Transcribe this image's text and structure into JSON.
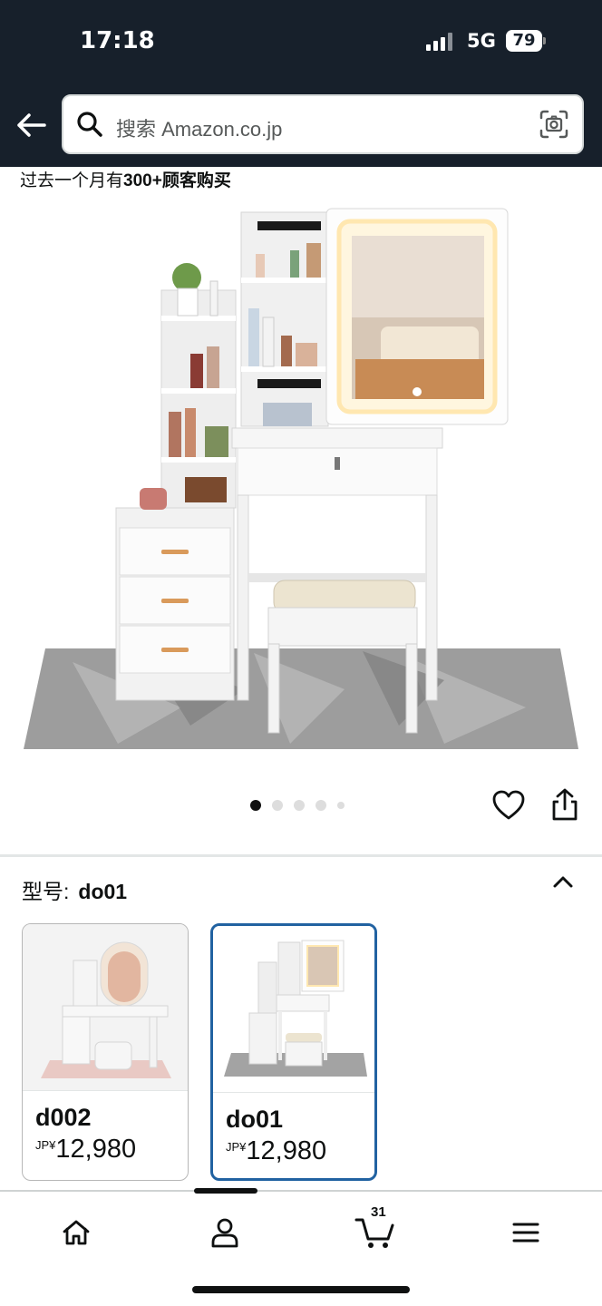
{
  "status_bar": {
    "time": "17:18",
    "network": "5G",
    "battery": "79"
  },
  "header": {
    "back_icon": "arrow-left-icon",
    "search": {
      "placeholder": "搜索 Amazon.co.jp",
      "search_icon": "magnifier-icon",
      "camera_icon": "camera-scan-icon"
    },
    "background_color": "#17202b"
  },
  "product": {
    "purchase_prefix": "过去一个月有",
    "purchase_count": "300+",
    "purchase_suffix": "顾客购买",
    "image_alt": "vanity-dressing-table-with-led-mirror",
    "carousel": {
      "total": 5,
      "active_index": 0
    },
    "actions": {
      "wishlist_icon": "heart-outline-icon",
      "share_icon": "share-icon"
    }
  },
  "model_selector": {
    "label": "型号:",
    "selected": "do01",
    "collapse_icon": "chevron-up-icon",
    "options": [
      {
        "name": "d002",
        "currency": "JP¥",
        "price": "12,980",
        "selected": false
      },
      {
        "name": "do01",
        "currency": "JP¥",
        "price": "12,980",
        "selected": true
      }
    ],
    "selected_border_color": "#2162a1"
  },
  "bottom_nav": {
    "items": [
      {
        "icon": "home-icon"
      },
      {
        "icon": "account-icon"
      },
      {
        "icon": "cart-icon",
        "badge": "31"
      },
      {
        "icon": "menu-icon"
      }
    ]
  }
}
